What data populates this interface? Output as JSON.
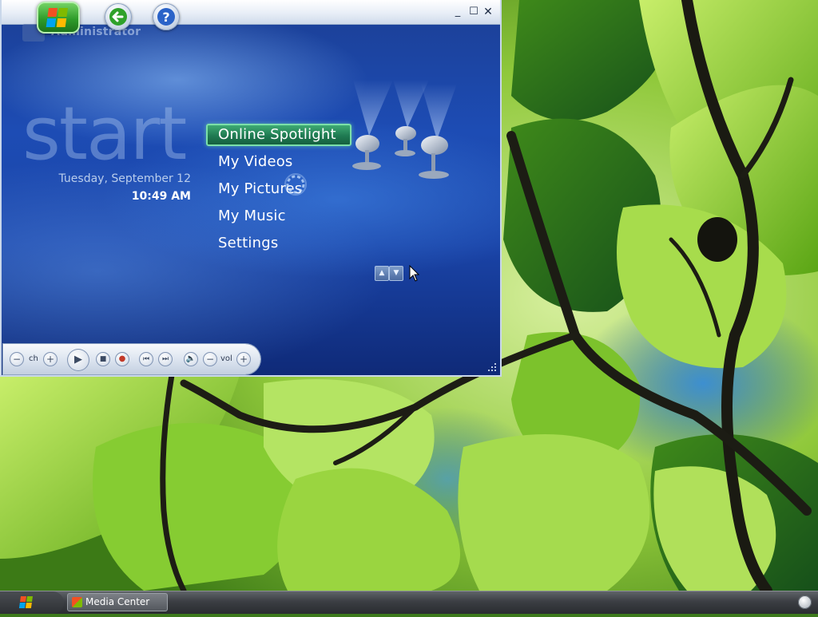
{
  "window": {
    "user": "Administrator",
    "controls": {
      "minimize": "_",
      "maximize": "☐",
      "close": "✕"
    }
  },
  "start": {
    "title": "start",
    "date": "Tuesday, September 12",
    "time": "10:49 AM"
  },
  "menu": {
    "items": [
      {
        "label": "Online Spotlight",
        "selected": true
      },
      {
        "label": "My Videos",
        "selected": false
      },
      {
        "label": "My Pictures",
        "selected": false
      },
      {
        "label": "My Music",
        "selected": false
      },
      {
        "label": "Settings",
        "selected": false
      }
    ]
  },
  "transport": {
    "ch_label": "ch",
    "vol_label": "vol",
    "minus": "−",
    "plus": "+",
    "play": "▶",
    "stop": "■",
    "record": "●",
    "prev": "⏮",
    "next": "⏭",
    "mute": "🔈"
  },
  "taskbar": {
    "task_label": "Media Center"
  },
  "colors": {
    "window_blue": "#1d4cb4",
    "selection_green": "#1f7a52",
    "leaf_green": "#8fd42a"
  },
  "icons": [
    "windows-logo-icon",
    "back-arrow-icon",
    "help-icon",
    "spotlight-icon",
    "scroll-up-icon",
    "scroll-down-icon",
    "mouse-cursor-icon",
    "busy-spinner-icon"
  ]
}
